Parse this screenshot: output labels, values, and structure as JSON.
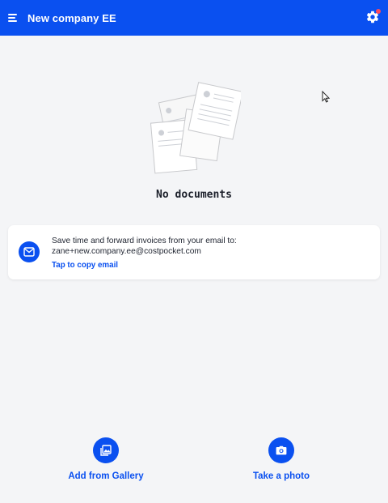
{
  "header": {
    "title": "New company EE",
    "menu_icon": "menu-icon",
    "settings_icon": "gear-icon",
    "notification_dot_color": "#ff4b5c",
    "brand_color": "#0a50f0"
  },
  "empty_state": {
    "illustration_icon": "documents-illustration-icon",
    "title": "No documents"
  },
  "email_card": {
    "icon": "mail-icon",
    "line1": "Save time and forward invoices from your email to:",
    "email": "zane+new.company.ee@costpocket.com",
    "copy_label": "Tap to copy email"
  },
  "actions": [
    {
      "icon": "gallery-icon",
      "label": "Add from Gallery"
    },
    {
      "icon": "camera-icon",
      "label": "Take a photo"
    }
  ]
}
